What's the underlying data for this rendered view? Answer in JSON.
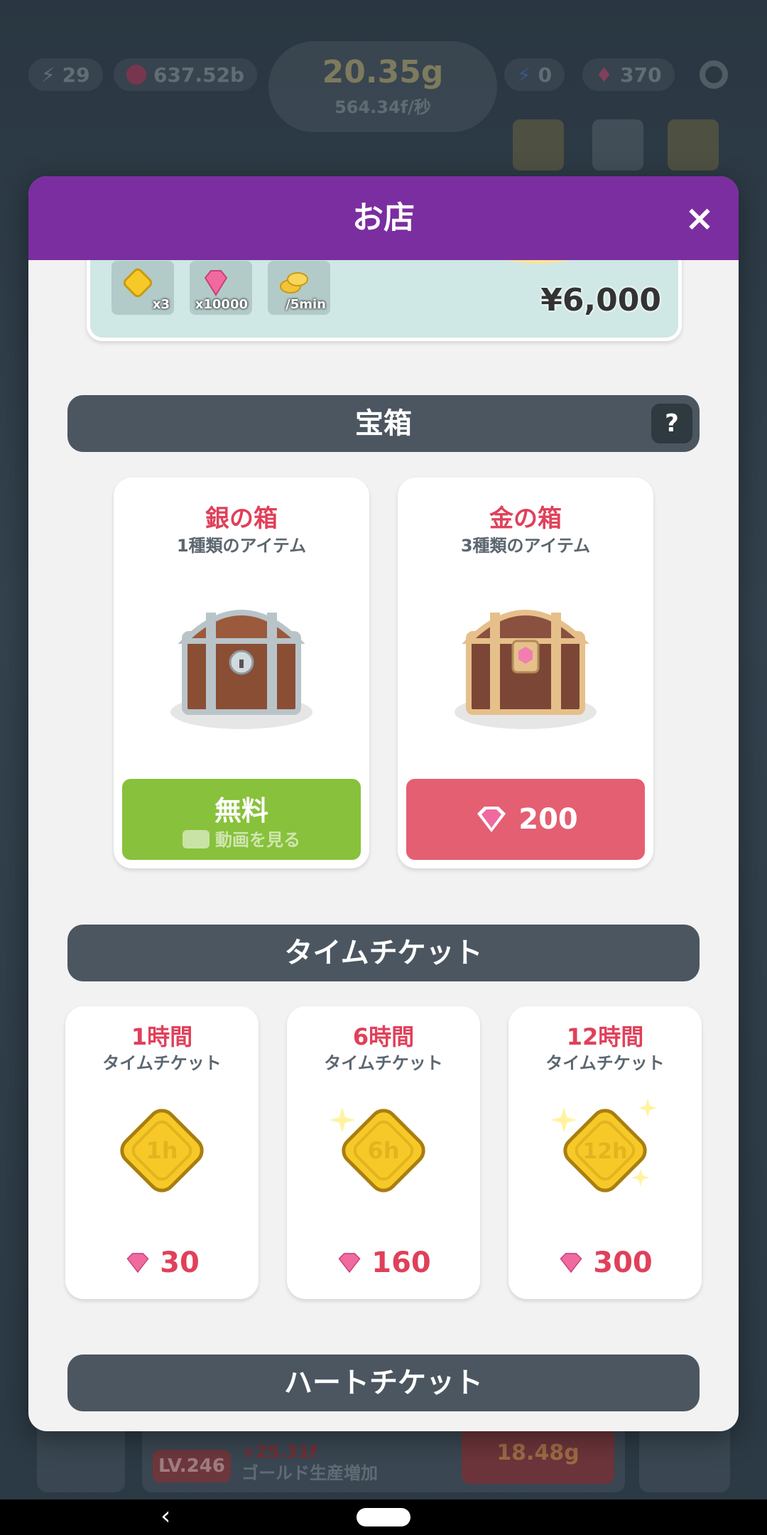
{
  "background": {
    "stat_trophies": "29",
    "stat_pink": "637.52b",
    "gold_amount": "20.35g",
    "gold_rate": "564.34f/秒",
    "stat_energy": "0",
    "stat_gems": "370",
    "bottom_level": "LV.246",
    "bottom_gain": "+25.31f",
    "bottom_desc": "ゴールド生産増加",
    "bottom_cost": "18.48g"
  },
  "modal": {
    "title": "お店",
    "close_glyph": "×"
  },
  "pack": {
    "items": [
      {
        "label": "x3",
        "icon": "time-ticket-icon"
      },
      {
        "label": "x10000",
        "icon": "gem-icon"
      },
      {
        "label": "/5min",
        "icon": "coins-icon"
      }
    ],
    "price": "¥6,000"
  },
  "chests": {
    "section_title": "宝箱",
    "help": "?",
    "silver": {
      "name": "銀の箱",
      "subtitle": "1種類のアイテム",
      "button_label": "無料",
      "button_sub": "動画を見る"
    },
    "gold": {
      "name": "金の箱",
      "subtitle": "3種類のアイテム",
      "price": "200"
    }
  },
  "time_tickets": {
    "section_title": "タイムチケット",
    "items": [
      {
        "name": "1時間",
        "subtitle": "タイムチケット",
        "badge": "1h",
        "price": "30"
      },
      {
        "name": "6時間",
        "subtitle": "タイムチケット",
        "badge": "6h",
        "price": "160"
      },
      {
        "name": "12時間",
        "subtitle": "タイムチケット",
        "badge": "12h",
        "price": "300"
      }
    ]
  },
  "heart_tickets": {
    "section_title": "ハートチケット"
  },
  "colors": {
    "header_purple": "#7b2ea0",
    "accent_red": "#e0405a",
    "free_green": "#88c13b",
    "gem_button": "#e45f72",
    "section_bar": "#4b5660"
  }
}
